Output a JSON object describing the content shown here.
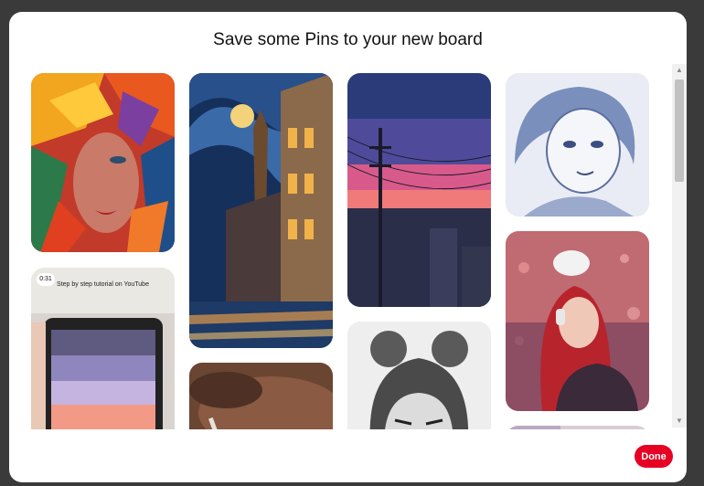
{
  "modal": {
    "title": "Save some Pins to your new board",
    "done_label": "Done"
  },
  "pins": {
    "tutorial": {
      "video_duration": "0:31",
      "caption": "Step by step tutorial on YouTube"
    }
  },
  "scrollbar": {
    "up_arrow": "▲",
    "down_arrow": "▼"
  },
  "colors": {
    "done_button": "#e60023",
    "backdrop": "#3a3a3a"
  },
  "icons": [
    "chevron-up-icon",
    "chevron-down-icon"
  ]
}
